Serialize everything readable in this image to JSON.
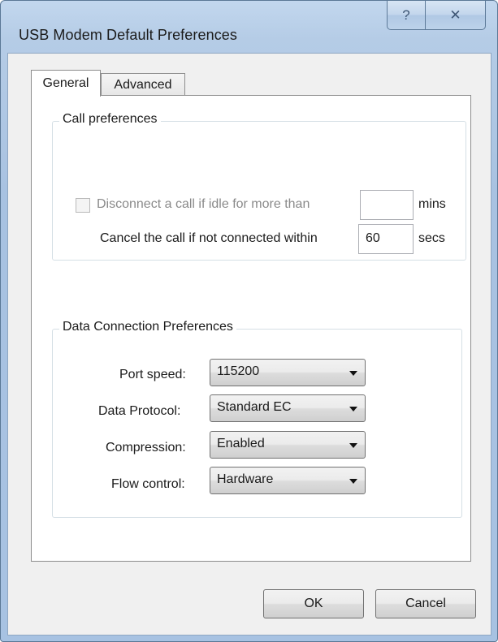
{
  "window": {
    "title": "USB Modem Default Preferences",
    "help_glyph": "?",
    "close_glyph": "✕"
  },
  "tabs": [
    {
      "label": "General",
      "selected": true
    },
    {
      "label": "Advanced",
      "selected": false
    }
  ],
  "call_preferences": {
    "legend": "Call preferences",
    "idle_disconnect": {
      "label": "Disconnect a call if idle for more than",
      "checked": false,
      "enabled": false,
      "value": "",
      "unit": "mins"
    },
    "cancel_call": {
      "label": "Cancel the call if not connected within",
      "value": "60",
      "unit": "secs"
    }
  },
  "data_connection": {
    "legend": "Data Connection Preferences",
    "fields": [
      {
        "label": "Port speed:",
        "value": "115200"
      },
      {
        "label": "Data Protocol:",
        "value": "Standard EC"
      },
      {
        "label": "Compression:",
        "value": "Enabled"
      },
      {
        "label": "Flow control:",
        "value": "Hardware"
      }
    ]
  },
  "buttons": {
    "ok": "OK",
    "cancel": "Cancel"
  }
}
